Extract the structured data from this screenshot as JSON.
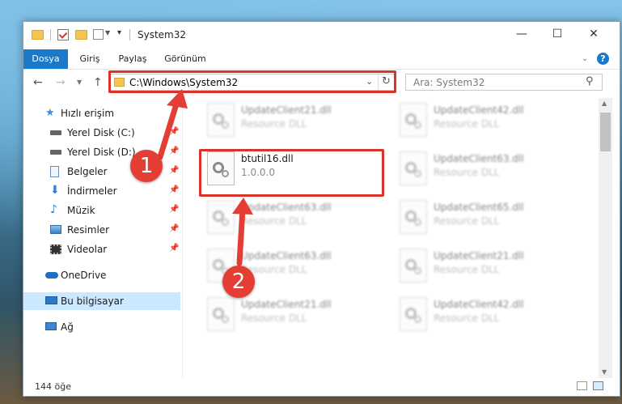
{
  "window": {
    "title": "System32"
  },
  "ribbon": {
    "tabs": [
      "Dosya",
      "Giriş",
      "Paylaş",
      "Görünüm"
    ],
    "active": "Dosya"
  },
  "address": {
    "path": "C:\\Windows\\System32"
  },
  "search": {
    "placeholder": "Ara: System32"
  },
  "sidebar": {
    "quick_access": "Hızlı erişim",
    "items": [
      {
        "label": "Yerel Disk (C:)",
        "icon": "drive-icon"
      },
      {
        "label": "Yerel Disk (D:)",
        "icon": "drive-icon"
      },
      {
        "label": "Belgeler",
        "icon": "document-icon"
      },
      {
        "label": "İndirmeler",
        "icon": "download-icon"
      },
      {
        "label": "Müzik",
        "icon": "music-icon"
      },
      {
        "label": "Resimler",
        "icon": "pictures-icon"
      },
      {
        "label": "Videolar",
        "icon": "video-icon"
      }
    ],
    "onedrive": "OneDrive",
    "this_pc": "Bu bilgisayar",
    "network": "Ağ"
  },
  "files": [
    {
      "name": "UpdateClient21.dll",
      "desc": "Resource DLL"
    },
    {
      "name": "UpdateClient42.dll",
      "desc": "Resource DLL"
    },
    {
      "name": "btutil16.dll",
      "desc": "1.0.0.0"
    },
    {
      "name": "UpdateClient63.dll",
      "desc": "Resource DLL"
    },
    {
      "name": "UpdateClient63.dll",
      "desc": "Resource DLL"
    },
    {
      "name": "UpdateClient65.dll",
      "desc": "Resource DLL"
    },
    {
      "name": "UpdateClient63.dll",
      "desc": "Resource DLL"
    },
    {
      "name": "UpdateClient21.dll",
      "desc": "Resource DLL"
    },
    {
      "name": "UpdateClient21.dll",
      "desc": "Resource DLL"
    },
    {
      "name": "UpdateClient42.dll",
      "desc": "Resource DLL"
    }
  ],
  "status": {
    "count": "144 öğe"
  },
  "annotations": {
    "badge1": "1",
    "badge2": "2",
    "color": "#d9342b"
  }
}
